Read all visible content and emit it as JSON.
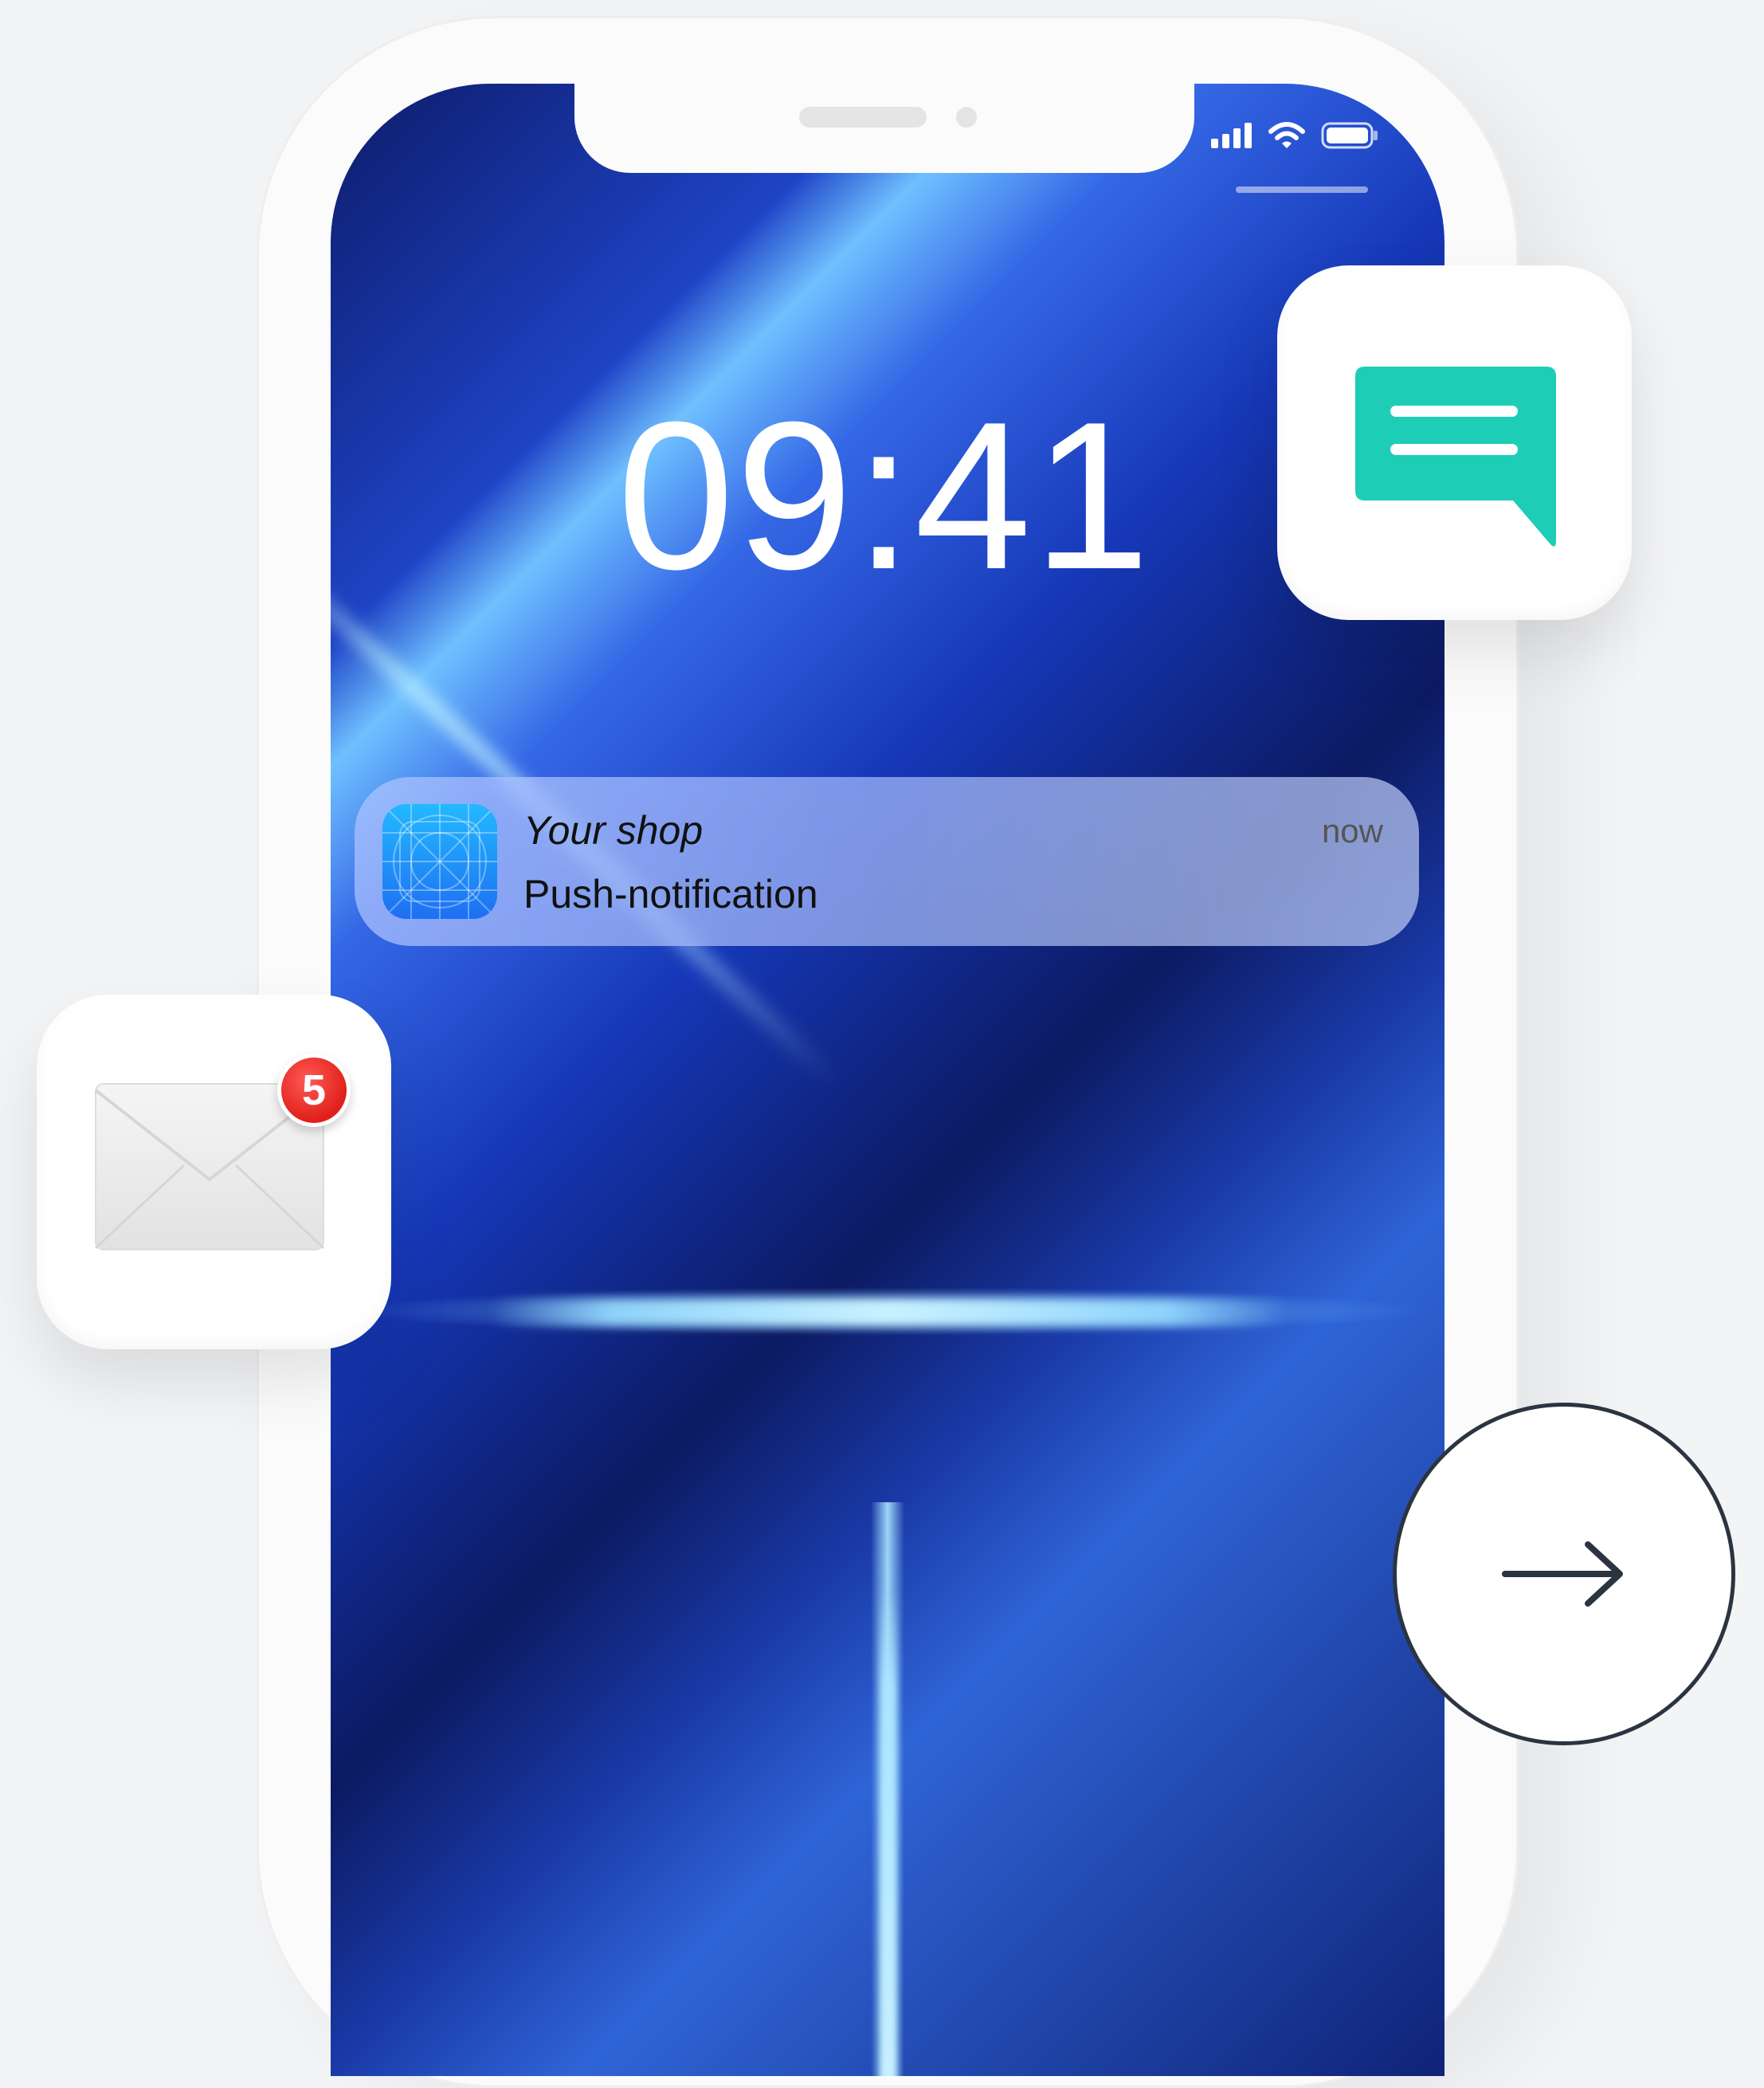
{
  "lock_screen": {
    "time": "09:41",
    "status_bar": {
      "icons": [
        "cellular-signal-icon",
        "wifi-icon",
        "battery-icon"
      ]
    }
  },
  "notification": {
    "app_name": "Your shop",
    "message": "Push-notification",
    "time": "now"
  },
  "floating_icons": {
    "chat": {
      "icon": "chat-bubble-icon",
      "color": "#1ecdb6"
    },
    "mail": {
      "icon": "envelope-icon",
      "badge_count": "5",
      "badge_color": "#e0201a"
    },
    "next": {
      "icon": "arrow-right-icon",
      "border_color": "#2b3440"
    }
  },
  "colors": {
    "background": "#f3f4f6",
    "phone_frame": "#fbfbfb",
    "wallpaper_primary": "#1e43c5"
  }
}
